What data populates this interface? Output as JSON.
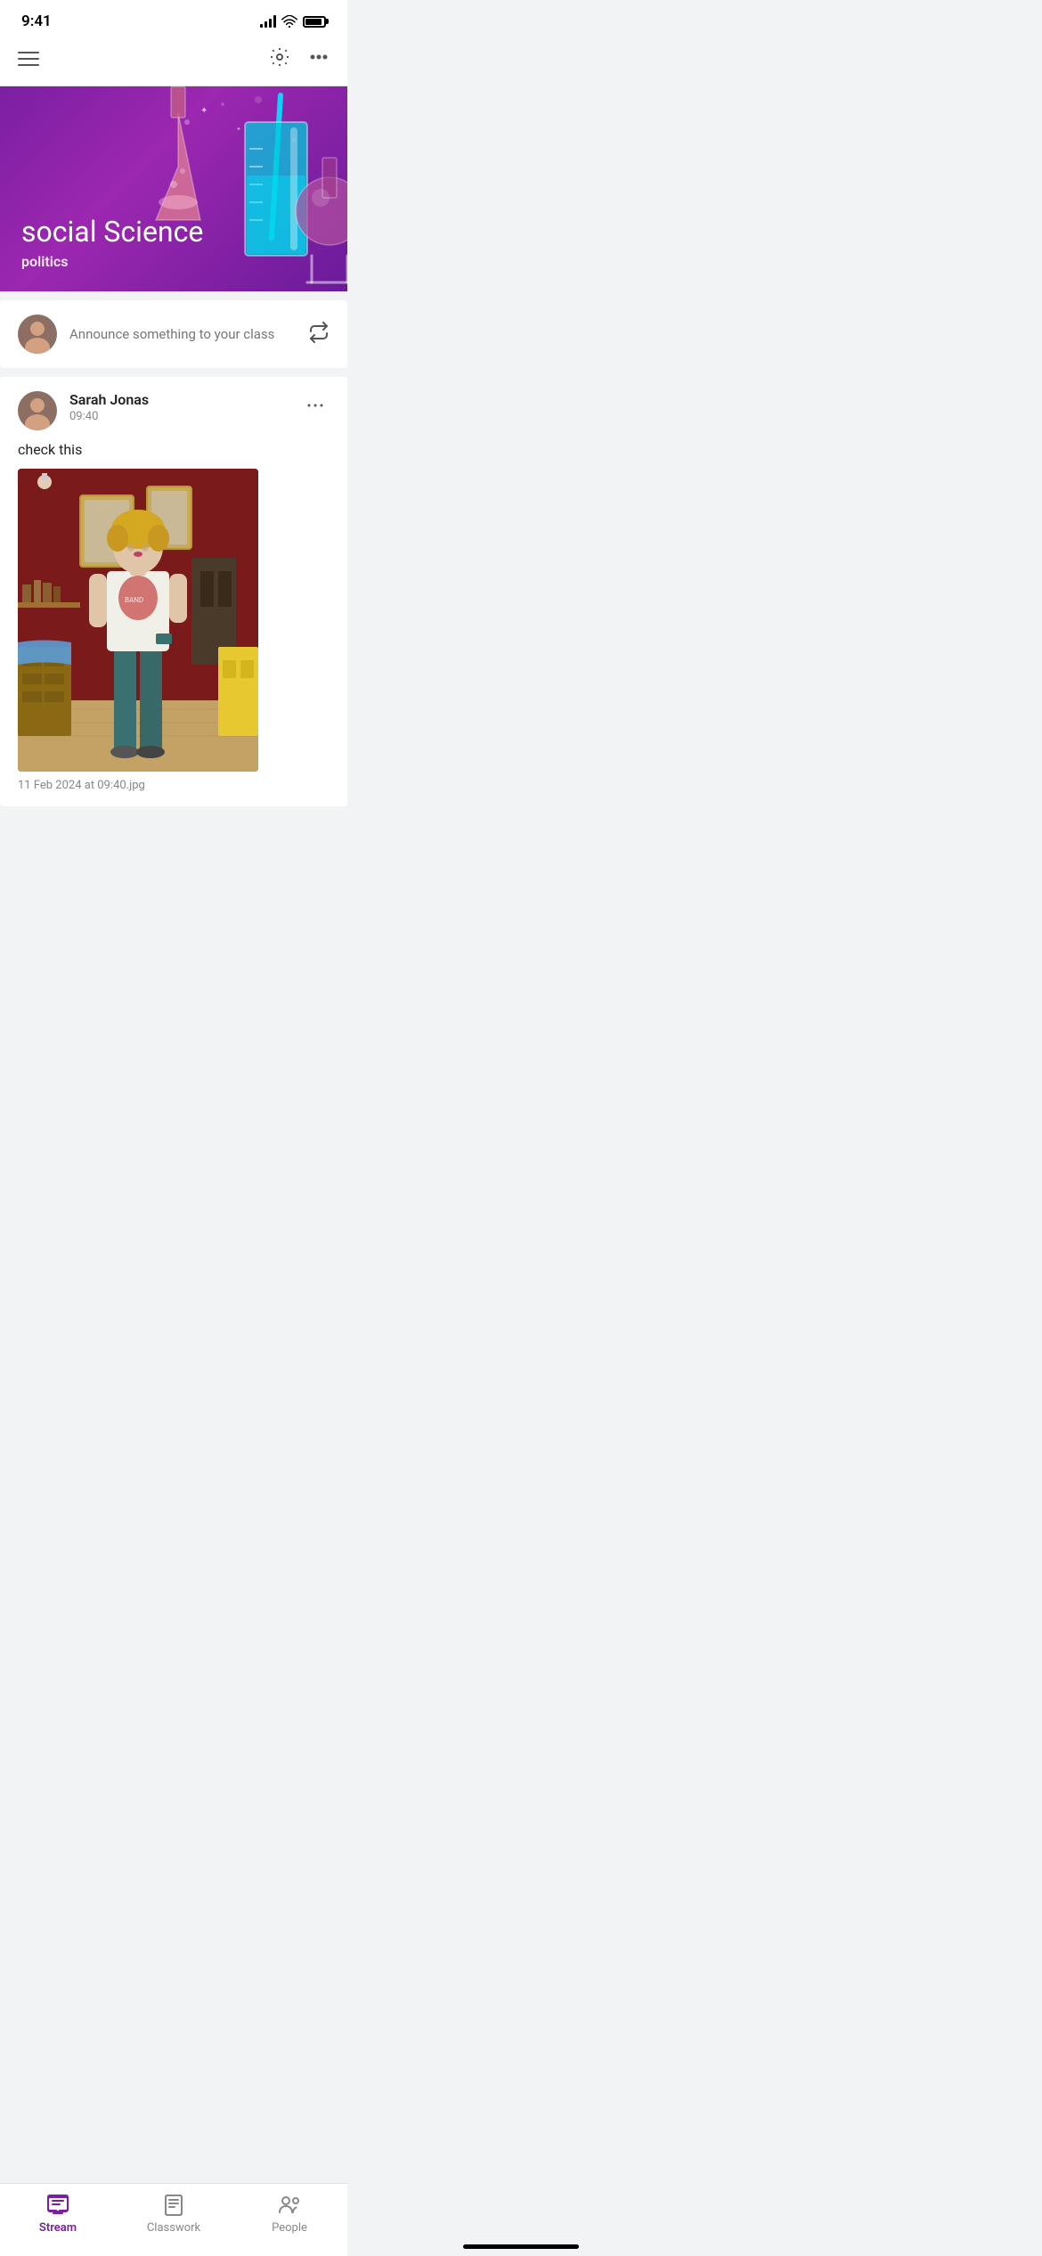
{
  "statusBar": {
    "time": "9:41"
  },
  "topNav": {
    "settingsLabel": "Settings",
    "moreLabel": "More options"
  },
  "heroBanner": {
    "title": "social Science",
    "subtitle": "politics"
  },
  "announceBar": {
    "placeholder": "Announce something to your class"
  },
  "post": {
    "author": "Sarah Jonas",
    "time": "09:40",
    "body": "check this",
    "caption": "11 Feb 2024 at 09:40.jpg",
    "moreLabel": "More"
  },
  "bottomNav": {
    "stream": "Stream",
    "classwork": "Classwork",
    "people": "People"
  }
}
